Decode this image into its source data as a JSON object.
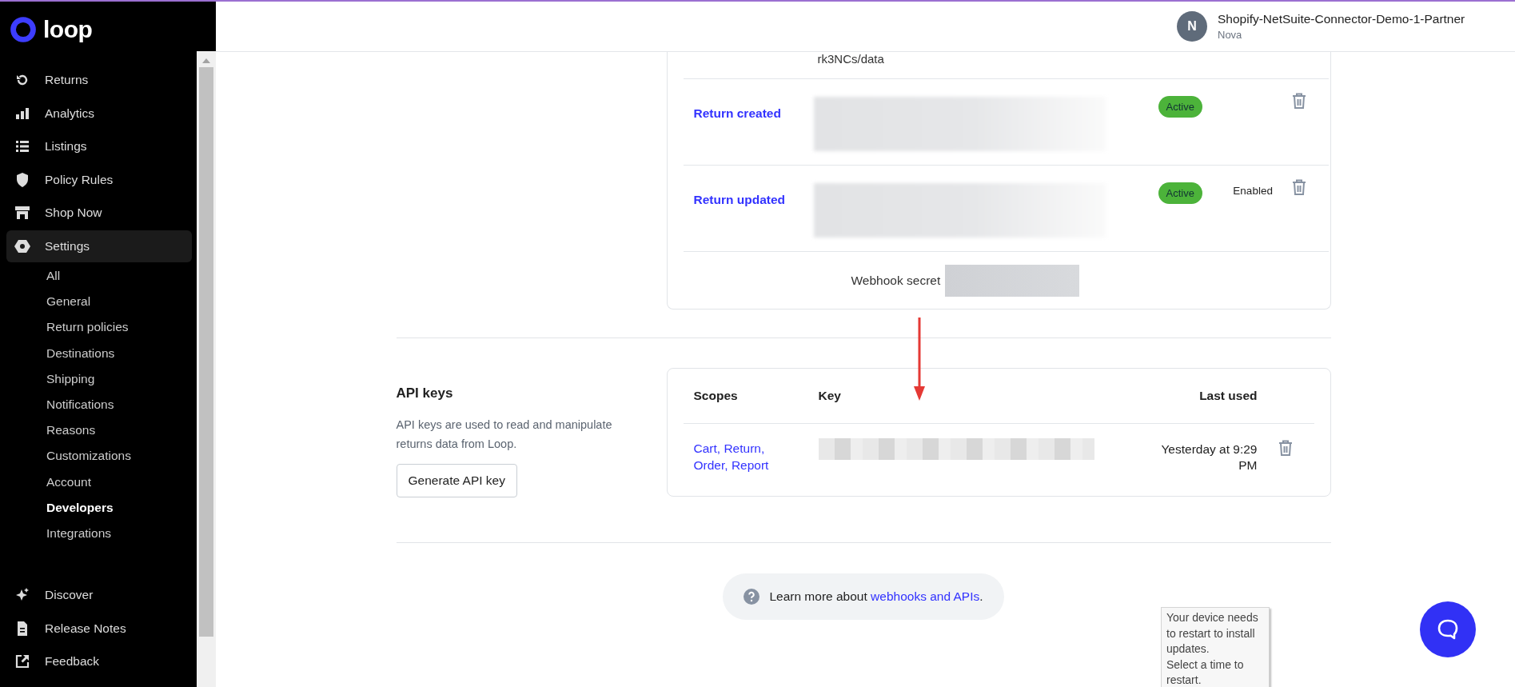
{
  "brand": {
    "name": "loop"
  },
  "account": {
    "initial": "N",
    "store": "Shopify-NetSuite-Connector-Demo-1-Partner",
    "user": "Nova"
  },
  "sidebar": {
    "items": [
      {
        "label": "Returns",
        "selected": false
      },
      {
        "label": "Analytics",
        "selected": false
      },
      {
        "label": "Listings",
        "selected": false
      },
      {
        "label": "Policy Rules",
        "selected": false
      },
      {
        "label": "Shop Now",
        "selected": false
      },
      {
        "label": "Settings",
        "selected": true,
        "children": [
          {
            "label": "All",
            "selected": false
          },
          {
            "label": "General",
            "selected": false
          },
          {
            "label": "Return policies",
            "selected": false
          },
          {
            "label": "Destinations",
            "selected": false
          },
          {
            "label": "Shipping",
            "selected": false
          },
          {
            "label": "Notifications",
            "selected": false
          },
          {
            "label": "Reasons",
            "selected": false
          },
          {
            "label": "Customizations",
            "selected": false
          },
          {
            "label": "Account",
            "selected": false
          },
          {
            "label": "Developers",
            "selected": true
          },
          {
            "label": "Integrations",
            "selected": false
          }
        ]
      }
    ],
    "footer_items": [
      {
        "label": "Discover",
        "selected": false
      },
      {
        "label": "Release Notes",
        "selected": false
      },
      {
        "label": "Feedback",
        "selected": false
      }
    ]
  },
  "webhooks": {
    "partial_url": "rk3NCs/data",
    "rows": [
      {
        "event": "Return created",
        "status": "Active"
      },
      {
        "event": "Return updated",
        "status": "Active",
        "note": "Enabled"
      }
    ],
    "secret_label": "Webhook secret"
  },
  "api_keys": {
    "title": "API keys",
    "description": "API keys are used to read and manipulate returns data from Loop.",
    "button": "Generate API key",
    "columns": [
      "Scopes",
      "Key",
      "Last used"
    ],
    "rows": [
      {
        "scopes": "Cart, Return, Order, Report",
        "last_used": "Yesterday at 9:29 PM"
      }
    ]
  },
  "help": {
    "text": "Learn more about ",
    "link": "webhooks and APIs",
    "end": "."
  },
  "tooltip": {
    "lines": [
      "Your device needs to restart to install updates.",
      "Select a time to restart."
    ]
  }
}
